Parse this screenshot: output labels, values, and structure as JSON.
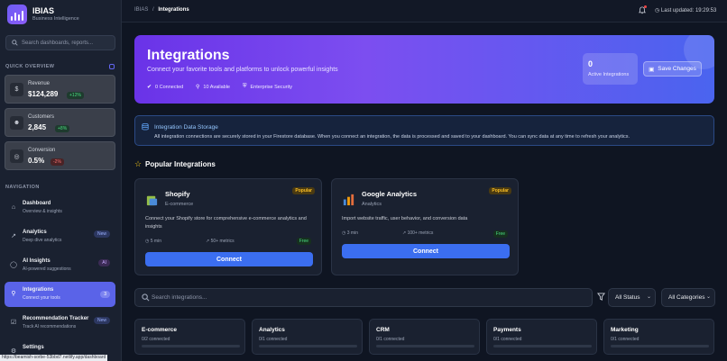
{
  "app": {
    "name": "IBIAS",
    "subtitle": "Business Intelligence"
  },
  "sidebar": {
    "search_placeholder": "Search dashboards, reports...",
    "overview_label": "QUICK OVERVIEW",
    "stats": [
      {
        "label": "Revenue",
        "value": "$124,289",
        "change": "+12%",
        "icon": "dollar-icon"
      },
      {
        "label": "Customers",
        "value": "2,845",
        "change": "+8%",
        "icon": "users-icon"
      },
      {
        "label": "Conversion",
        "value": "0.5%",
        "change": "-2%",
        "icon": "target-icon"
      }
    ],
    "nav_label": "NAVIGATION",
    "nav": [
      {
        "title": "Dashboard",
        "sub": "Overview & insights",
        "badge": ""
      },
      {
        "title": "Analytics",
        "sub": "Deep dive analytics",
        "badge": "New"
      },
      {
        "title": "AI Insights",
        "sub": "AI-powered suggestions",
        "badge": "AI"
      },
      {
        "title": "Integrations",
        "sub": "Connect your tools",
        "badge": "3"
      },
      {
        "title": "Recommendation Tracker",
        "sub": "Track AI recommendations",
        "badge": "New"
      },
      {
        "title": "Settings",
        "sub": "",
        "badge": ""
      }
    ],
    "status_url": "https://beamish-sorbe-53bbd7.netlify.app/dashboard"
  },
  "topbar": {
    "breadcrumb_root": "IBIAS",
    "breadcrumb_sep": "/",
    "breadcrumb_current": "Integrations",
    "last_updated": "Last updated: 19:29:53"
  },
  "hero": {
    "title": "Integrations",
    "subtitle": "Connect your favorite tools and platforms to unlock powerful insights",
    "connected": "0 Connected",
    "available": "10 Available",
    "security": "Enterprise Security",
    "active_count": "0",
    "active_label": "Active Integrations",
    "save_label": "Save Changes"
  },
  "notice": {
    "title": "Integration Data Storage",
    "body": "All integration connections are securely stored in your Firestore database. When you connect an integration, the data is processed and saved to your dashboard. You can sync data at any time to refresh your analytics."
  },
  "popular": {
    "title": "Popular Integrations",
    "cards": [
      {
        "name": "Shopify",
        "category": "E-commerce",
        "badge": "Popular",
        "description": "Connect your Shopify store for comprehensive e-commerce analytics and insights",
        "time": "5 min",
        "metrics": "50+ metrics",
        "price": "Free",
        "button": "Connect"
      },
      {
        "name": "Google Analytics",
        "category": "Analytics",
        "badge": "Popular",
        "description": "Import website traffic, user behavior, and conversion data",
        "time": "3 min",
        "metrics": "100+ metrics",
        "price": "Free",
        "button": "Connect"
      }
    ]
  },
  "filters": {
    "search_placeholder": "Search integrations...",
    "status": "All Status",
    "category": "All Categories"
  },
  "categories": [
    {
      "name": "E-commerce",
      "count": "0/2 connected"
    },
    {
      "name": "Analytics",
      "count": "0/1 connected"
    },
    {
      "name": "CRM",
      "count": "0/1 connected"
    },
    {
      "name": "Payments",
      "count": "0/1 connected"
    },
    {
      "name": "Marketing",
      "count": "0/1 connected"
    }
  ],
  "colors": {
    "accent": "#5a63e8",
    "hero_start": "#6a33e8",
    "hero_end": "#4a64ef",
    "connect": "#3b6ef0"
  }
}
